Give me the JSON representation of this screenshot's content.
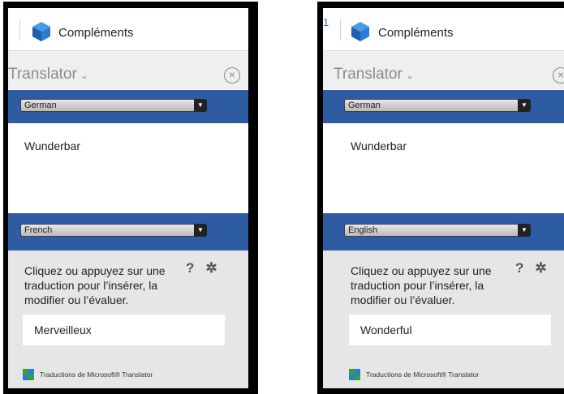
{
  "panels": [
    {
      "topbar": {
        "superscript": "",
        "title": "Compléments"
      },
      "header": {
        "app_name": "Translator",
        "chevron": "⌄",
        "close": "×"
      },
      "source_language": "German",
      "source_text": "Wunderbar",
      "target_language": "French",
      "tools": {
        "help": "?",
        "settings": "✲"
      },
      "instructions": "Cliquez ou appuyez sur une traduction pour l’insérer, la modifier ou l’évaluer.",
      "result": "Merveilleux",
      "footer": "Traductions de Microsoft® Translator"
    },
    {
      "topbar": {
        "superscript": "1",
        "title": "Compléments"
      },
      "header": {
        "app_name": "Translator",
        "chevron": "⌄",
        "close": "×"
      },
      "source_language": "German",
      "source_text": "Wunderbar",
      "target_language": "English",
      "tools": {
        "help": "?",
        "settings": "✲"
      },
      "instructions": "Cliquez ou appuyez sur une traduction pour l’insérer, la modifier ou l’évaluer.",
      "result": "Wonderful",
      "footer": "Traductions de Microsoft® Translator"
    }
  ],
  "colors": {
    "accent_band": "#2e5ca3",
    "cube_icon": "#2b7cd3",
    "results_bg": "#e6e6e6"
  }
}
